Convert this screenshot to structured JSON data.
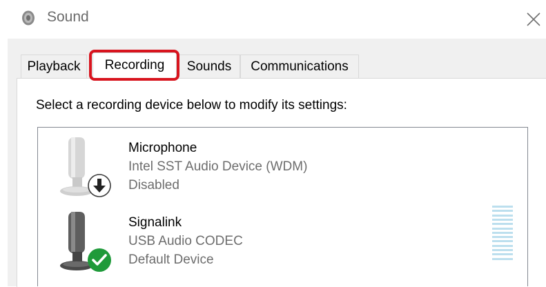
{
  "window": {
    "title": "Sound",
    "icon": "speaker-icon",
    "close_icon": "close-icon"
  },
  "tabs": [
    {
      "label": "Playback",
      "active": false
    },
    {
      "label": "Recording",
      "active": true
    },
    {
      "label": "Sounds",
      "active": false
    },
    {
      "label": "Communications",
      "active": false
    }
  ],
  "instruction": "Select a recording device below to modify its settings:",
  "devices": [
    {
      "name": "Microphone",
      "driver": "Intel SST Audio Device (WDM)",
      "status": "Disabled",
      "icon": "microphone-icon",
      "badge": "disabled-arrow-icon"
    },
    {
      "name": "Signalink",
      "driver": "USB Audio CODEC",
      "status": "Default Device",
      "icon": "microphone-icon",
      "badge": "default-check-icon",
      "level_meter_segments": 13
    }
  ],
  "colors": {
    "highlight": "#d8141e",
    "default_badge": "#1f9a3a",
    "level_meter": "#bcdfee"
  }
}
